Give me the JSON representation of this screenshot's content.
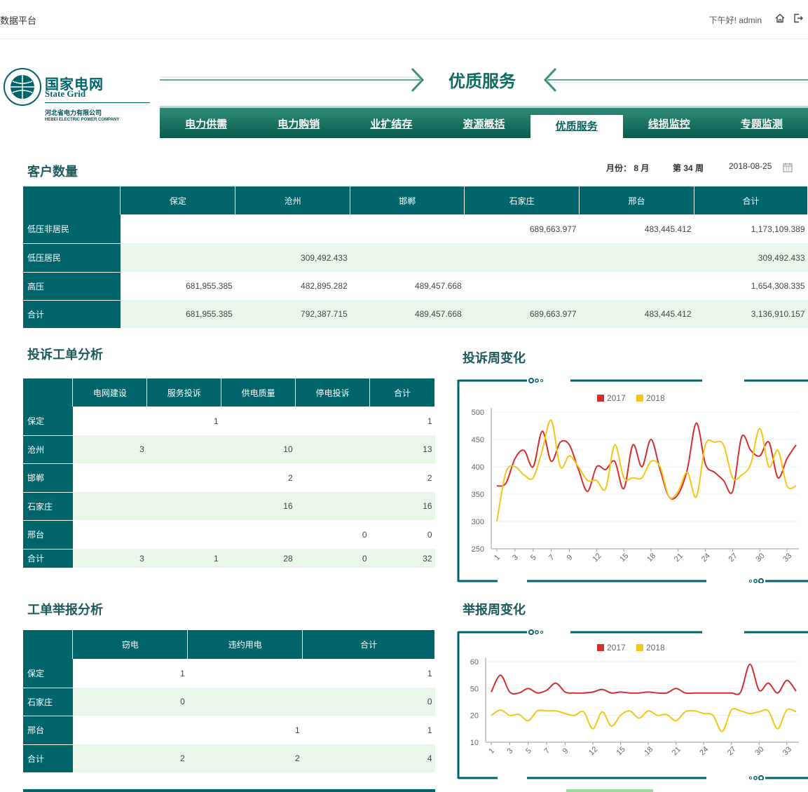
{
  "header": {
    "app_title": "数据平台",
    "greeting": "下午好! admin",
    "home_icon": "home-icon",
    "logout_icon": "logout-icon"
  },
  "logo": {
    "name_cn": "国家电网",
    "name_en": "State Grid",
    "sub_cn": "河北省电力有限公司",
    "sub_en": "HEBEI ELECTRIC POWER COMPANY"
  },
  "banner": {
    "title": "优质服务"
  },
  "nav": {
    "tabs": [
      {
        "label": "电力供需",
        "active": false
      },
      {
        "label": "电力购销",
        "active": false
      },
      {
        "label": "业扩结存",
        "active": false
      },
      {
        "label": "资源概括",
        "active": false
      },
      {
        "label": "优质服务",
        "active": true
      },
      {
        "label": "线损监控",
        "active": false
      },
      {
        "label": "专题监测",
        "active": false
      }
    ]
  },
  "customers": {
    "title": "客户数量",
    "month_label": "月份：",
    "month_value": "8",
    "month_unit": "月",
    "week_label": "第",
    "week_value": "34",
    "week_unit": "周",
    "date": "2018-08-25",
    "calendar_icon": "calendar-icon",
    "columns": [
      "保定",
      "沧州",
      "邯郸",
      "石家庄",
      "邢台",
      "合计"
    ],
    "rows": [
      {
        "label": "低压非居民",
        "cells": [
          "",
          "",
          "",
          "689,663.977",
          "483,445.412",
          "1,173,109.389"
        ]
      },
      {
        "label": "低压居民",
        "cells": [
          "",
          "309,492.433",
          "",
          "",
          "",
          "309,492.433"
        ]
      },
      {
        "label": "高压",
        "cells": [
          "681,955.385",
          "482,895.282",
          "489,457.668",
          "",
          "",
          "1,654,308.335"
        ]
      },
      {
        "label": "合计",
        "cells": [
          "681,955.385",
          "792,387.715",
          "489,457.668",
          "689,663.977",
          "483,445.412",
          "3,136,910.157"
        ]
      }
    ]
  },
  "complaints": {
    "title": "投诉工单分析",
    "columns": [
      "电网建设",
      "服务投诉",
      "供电质量",
      "停电投诉",
      "合计"
    ],
    "rows": [
      {
        "label": "保定",
        "cells": [
          "",
          "1",
          "",
          "",
          "1"
        ]
      },
      {
        "label": "沧州",
        "cells": [
          "3",
          "",
          "10",
          "",
          "13"
        ]
      },
      {
        "label": "邯郸",
        "cells": [
          "",
          "",
          "2",
          "",
          "2"
        ]
      },
      {
        "label": "石家庄",
        "cells": [
          "",
          "",
          "16",
          "",
          "16"
        ]
      },
      {
        "label": "邢台",
        "cells": [
          "",
          "",
          "",
          "0",
          "0"
        ]
      },
      {
        "label": "合计",
        "cells": [
          "3",
          "1",
          "28",
          "0",
          "32"
        ]
      }
    ]
  },
  "reports": {
    "title": "工单举报分析",
    "columns": [
      "窃电",
      "违约用电",
      "合计"
    ],
    "rows": [
      {
        "label": "保定",
        "cells": [
          "1",
          "",
          "1"
        ]
      },
      {
        "label": "石家庄",
        "cells": [
          "0",
          "",
          "0"
        ]
      },
      {
        "label": "邢台",
        "cells": [
          "",
          "1",
          "1"
        ]
      },
      {
        "label": "合计",
        "cells": [
          "2",
          "2",
          "4"
        ]
      }
    ]
  },
  "colors": {
    "primary": "#00656a",
    "series_2017": "#d32f2f",
    "series_2018": "#f5c518",
    "alt_row": "#e9f6ea"
  },
  "chart_data": [
    {
      "title": "投诉周变化",
      "type": "line",
      "x": [
        1,
        2,
        3,
        4,
        5,
        6,
        7,
        8,
        9,
        10,
        11,
        12,
        13,
        14,
        15,
        16,
        17,
        18,
        19,
        20,
        21,
        22,
        23,
        24,
        25,
        26,
        27,
        28,
        29,
        30,
        31,
        32,
        33,
        34
      ],
      "xticks": [
        "1",
        "3",
        "5",
        "7",
        "9",
        "12",
        "15",
        "18",
        "21",
        "24",
        "27",
        "30",
        "33"
      ],
      "ylim": [
        250,
        500
      ],
      "yticks": [
        250,
        300,
        350,
        400,
        450,
        500
      ],
      "series": [
        {
          "name": "2017",
          "values": [
            365,
            370,
            415,
            430,
            400,
            465,
            410,
            445,
            440,
            395,
            355,
            400,
            395,
            410,
            360,
            440,
            400,
            450,
            395,
            345,
            350,
            395,
            480,
            405,
            390,
            375,
            355,
            455,
            430,
            420,
            445,
            380,
            415,
            440
          ]
        },
        {
          "name": "2018",
          "values": [
            300,
            390,
            400,
            385,
            380,
            430,
            485,
            400,
            420,
            400,
            375,
            375,
            360,
            440,
            380,
            380,
            380,
            410,
            400,
            345,
            355,
            390,
            345,
            440,
            445,
            440,
            380,
            385,
            405,
            470,
            400,
            430,
            365,
            365
          ]
        }
      ]
    },
    {
      "title": "举报周变化",
      "type": "line",
      "x": [
        1,
        2,
        3,
        4,
        5,
        6,
        7,
        8,
        9,
        10,
        11,
        12,
        13,
        14,
        15,
        16,
        17,
        18,
        19,
        20,
        21,
        22,
        23,
        24,
        25,
        26,
        27,
        28,
        29,
        30,
        31,
        32,
        33,
        34
      ],
      "xticks": [
        "1",
        "3",
        "5",
        "7",
        "9",
        "12",
        "15",
        "18",
        "21",
        "24",
        "27",
        "30",
        "33"
      ],
      "ylim": [
        10,
        60
      ],
      "yticks": [
        10,
        20,
        50,
        60
      ],
      "series": [
        {
          "name": "2017",
          "values": [
            46,
            55,
            46,
            45,
            50,
            45,
            48,
            52,
            46,
            45,
            45,
            46,
            49,
            45,
            46,
            45,
            45,
            46,
            45,
            45,
            50,
            45,
            45,
            45,
            45,
            45,
            45,
            46,
            59,
            48,
            52,
            45,
            53,
            47
          ]
        },
        {
          "name": "2018",
          "values": [
            20,
            26,
            20,
            21,
            18,
            25,
            25,
            25,
            22,
            20,
            24,
            15,
            24,
            16,
            20,
            25,
            19,
            25,
            20,
            21,
            18,
            24,
            25,
            22,
            20,
            14,
            26,
            25,
            22,
            24,
            25,
            15,
            26,
            24
          ]
        }
      ]
    }
  ]
}
